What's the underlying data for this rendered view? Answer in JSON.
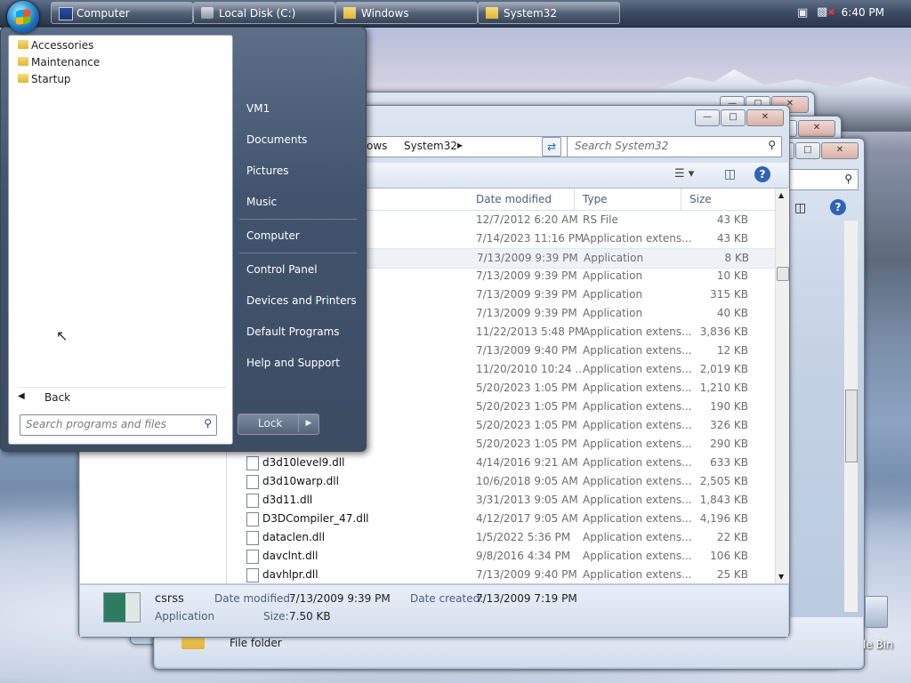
{
  "taskbar": {
    "buttons": [
      {
        "label": "Computer",
        "icon": "computer-icon"
      },
      {
        "label": "Local Disk (C:)",
        "icon": "drive-icon"
      },
      {
        "label": "Windows",
        "icon": "folder-icon"
      },
      {
        "label": "System32",
        "icon": "folder-icon"
      }
    ],
    "clock": "6:40 PM"
  },
  "start_menu": {
    "programs": [
      "Accessories",
      "Maintenance",
      "Startup"
    ],
    "back_label": "Back",
    "search_placeholder": "Search programs and files",
    "right_items": [
      "VM1",
      "Documents",
      "Pictures",
      "Music",
      "Computer",
      "Control Panel",
      "Devices and Printers",
      "Default Programs",
      "Help and Support"
    ],
    "lock_label": "Lock"
  },
  "explorer": {
    "address": {
      "part1": "ows",
      "part2": "System32"
    },
    "search_placeholder": "Search System32",
    "columns": {
      "date": "Date modified",
      "type": "Type",
      "size": "Size"
    },
    "rows": [
      {
        "name": "",
        "date": "12/7/2012 6:20 AM",
        "type": "RS File",
        "size": "43 KB"
      },
      {
        "name": "",
        "date": "7/14/2023 11:16 PM",
        "type": "Application extens...",
        "size": "43 KB"
      },
      {
        "name": "",
        "date": "7/13/2009 9:39 PM",
        "type": "Application",
        "size": "8 KB"
      },
      {
        "name": "",
        "date": "7/13/2009 9:39 PM",
        "type": "Application",
        "size": "10 KB"
      },
      {
        "name": "",
        "date": "7/13/2009 9:39 PM",
        "type": "Application",
        "size": "315 KB"
      },
      {
        "name": "",
        "date": "7/13/2009 9:39 PM",
        "type": "Application",
        "size": "40 KB"
      },
      {
        "name": "",
        "date": "11/22/2013 5:48 PM",
        "type": "Application extens...",
        "size": "3,836 KB"
      },
      {
        "name": "",
        "date": "7/13/2009 9:40 PM",
        "type": "Application extens...",
        "size": "12 KB"
      },
      {
        "name": "",
        "date": "11/20/2010 10:24 ...",
        "type": "Application extens...",
        "size": "2,019 KB"
      },
      {
        "name": "",
        "date": "5/20/2023 1:05 PM",
        "type": "Application extens...",
        "size": "1,210 KB"
      },
      {
        "name": "",
        "date": "5/20/2023 1:05 PM",
        "type": "Application extens...",
        "size": "190 KB"
      },
      {
        "name": "",
        "date": "5/20/2023 1:05 PM",
        "type": "Application extens...",
        "size": "326 KB"
      },
      {
        "name": "",
        "date": "5/20/2023 1:05 PM",
        "type": "Application extens...",
        "size": "290 KB"
      },
      {
        "name": "d3d10level9.dll",
        "date": "4/14/2016 9:21 AM",
        "type": "Application extens...",
        "size": "633 KB"
      },
      {
        "name": "d3d10warp.dll",
        "date": "10/6/2018 9:05 AM",
        "type": "Application extens...",
        "size": "2,505 KB"
      },
      {
        "name": "d3d11.dll",
        "date": "3/31/2013 9:05 AM",
        "type": "Application extens...",
        "size": "1,843 KB"
      },
      {
        "name": "D3DCompiler_47.dll",
        "date": "4/12/2017 9:05 AM",
        "type": "Application extens...",
        "size": "4,196 KB"
      },
      {
        "name": "dataclen.dll",
        "date": "1/5/2022 5:36 PM",
        "type": "Application extens...",
        "size": "22 KB"
      },
      {
        "name": "davclnt.dll",
        "date": "9/8/2016 4:34 PM",
        "type": "Application extens...",
        "size": "106 KB"
      },
      {
        "name": "davhlpr.dll",
        "date": "7/13/2009 9:40 PM",
        "type": "Application extens...",
        "size": "25 KB"
      }
    ],
    "details": {
      "name": "csrss",
      "kind": "Application",
      "modified_label": "Date modified:",
      "modified_value": "7/13/2009 9:39 PM",
      "created_label": "Date created:",
      "created_value": "7/13/2009 7:19 PM",
      "size_label": "Size:",
      "size_value": "7.50 KB"
    }
  },
  "background_window": {
    "status_text": "File folder"
  },
  "desktop": {
    "recycle_bin_label": "le Bin"
  }
}
